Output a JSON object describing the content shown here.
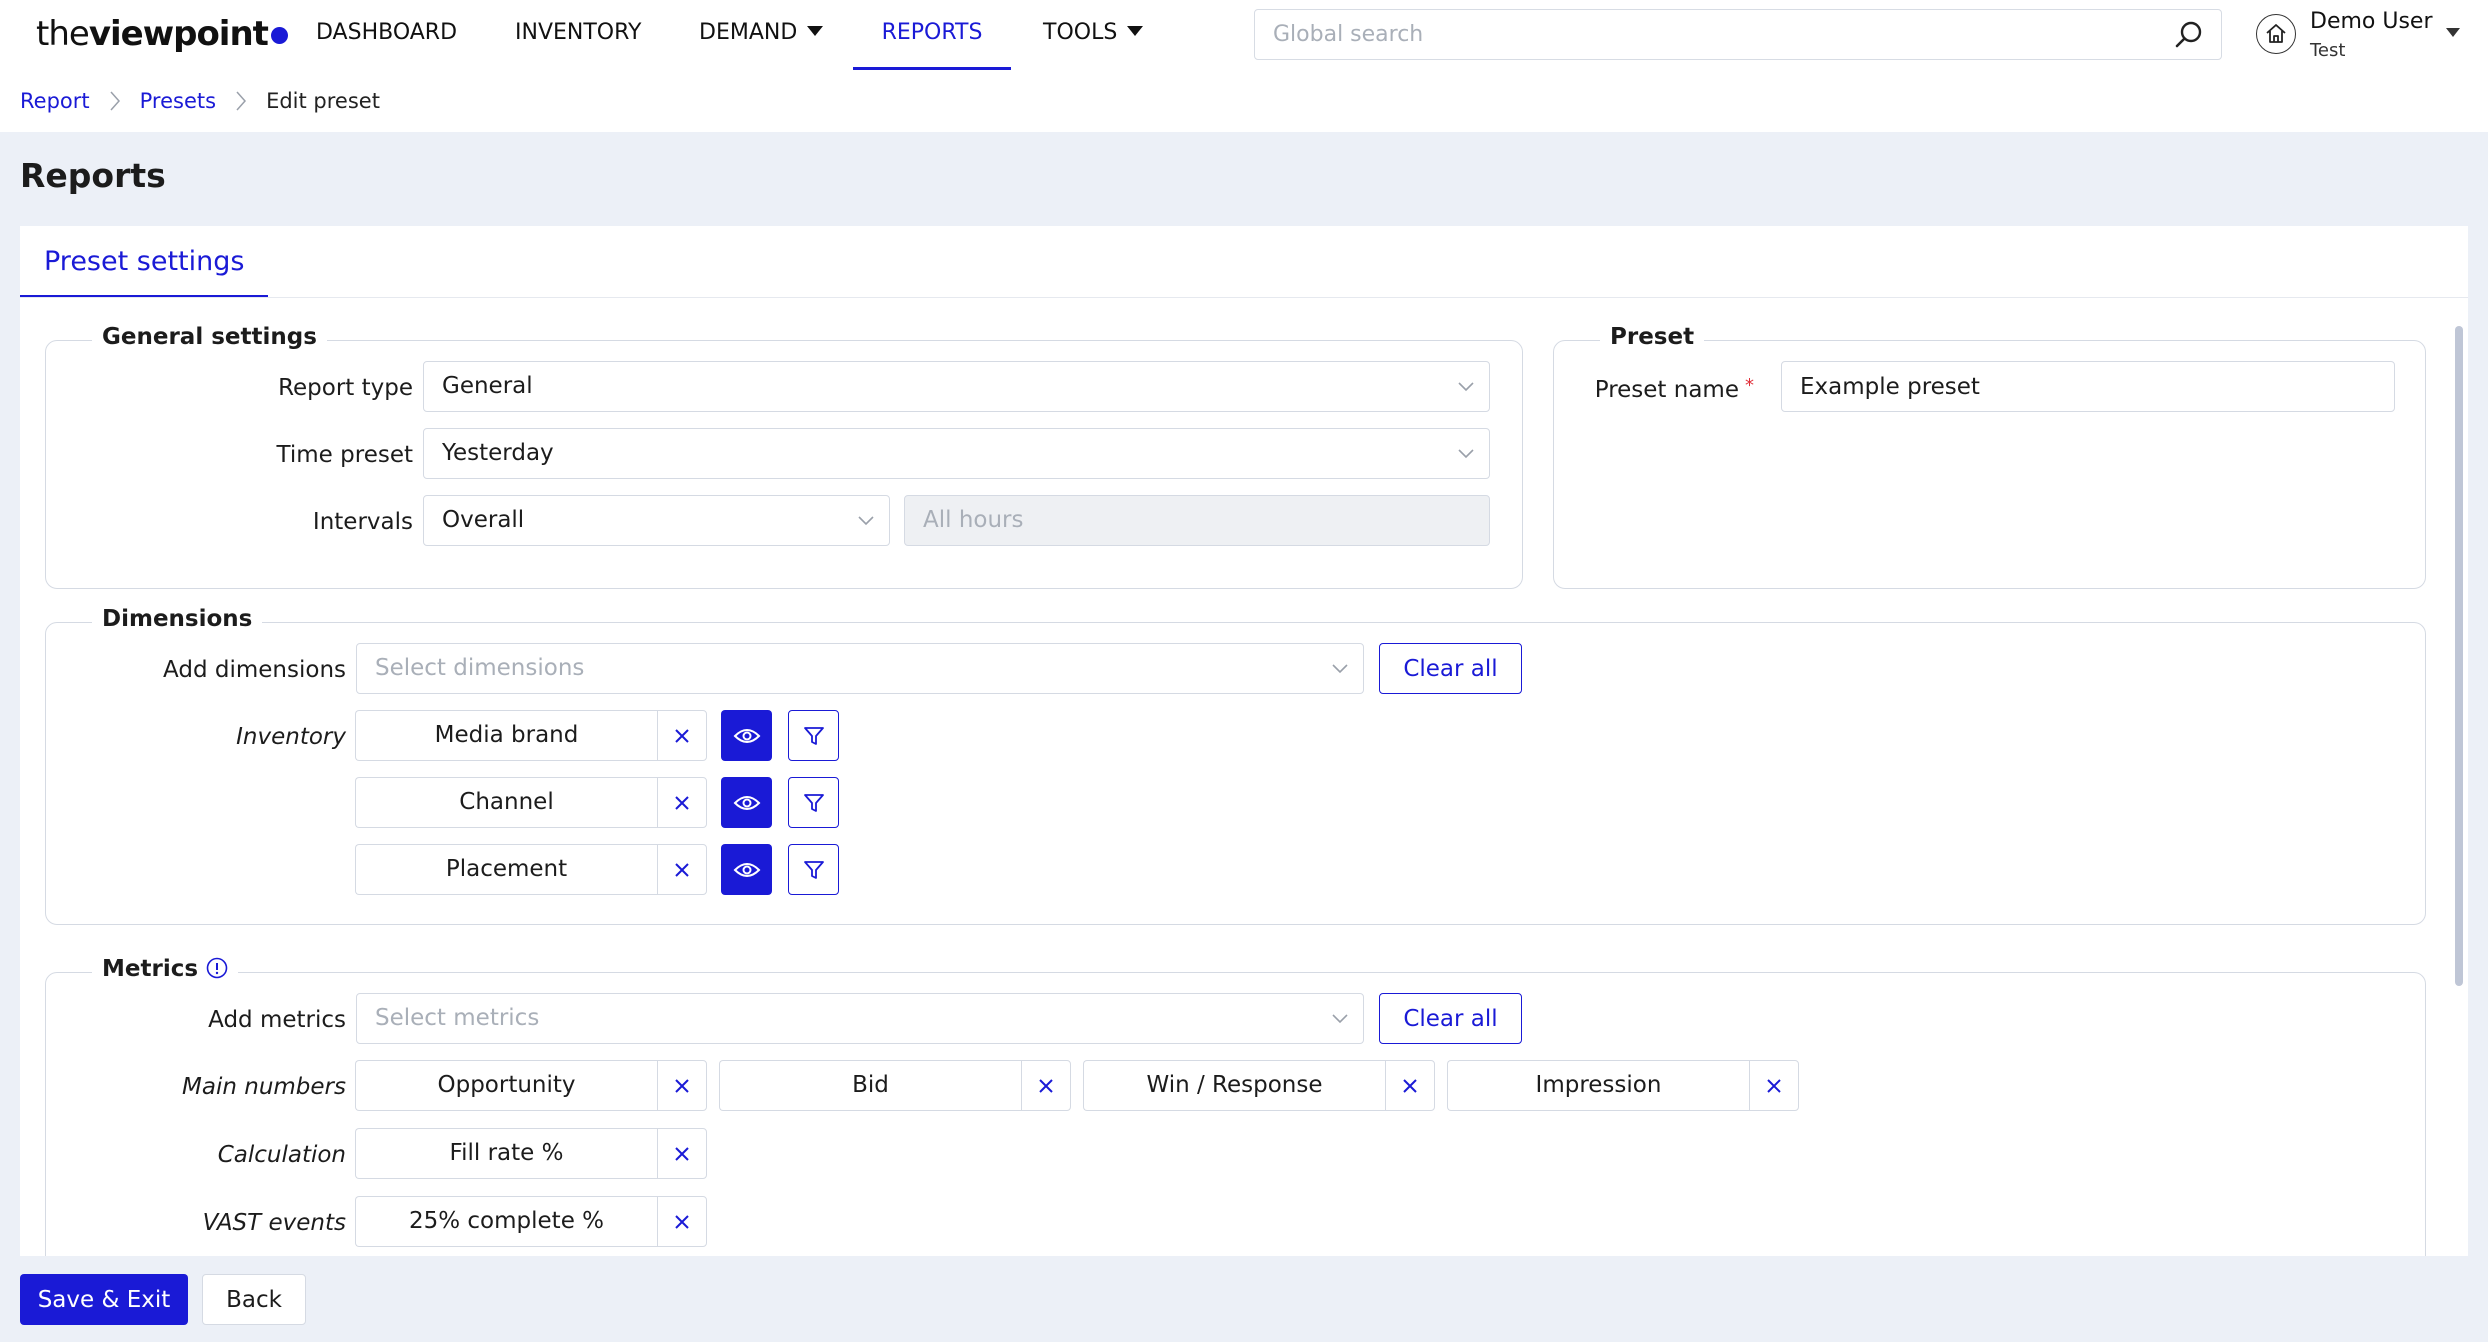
{
  "brand": {
    "logo_light": "the",
    "logo_bold": "viewpoint",
    "accent": "#1a1ad6"
  },
  "nav": {
    "items": [
      {
        "label": "DASHBOARD",
        "dropdown": false,
        "active": false
      },
      {
        "label": "INVENTORY",
        "dropdown": false,
        "active": false
      },
      {
        "label": "DEMAND",
        "dropdown": true,
        "active": false
      },
      {
        "label": "REPORTS",
        "dropdown": false,
        "active": true
      },
      {
        "label": "TOOLS",
        "dropdown": true,
        "active": false
      }
    ],
    "search_placeholder": "Global search",
    "user": {
      "name": "Demo User",
      "sub": "Test"
    }
  },
  "breadcrumb": {
    "items": [
      "Report",
      "Presets"
    ],
    "current": "Edit preset"
  },
  "page_title": "Reports",
  "tab": "Preset settings",
  "general": {
    "title": "General settings",
    "report_type_label": "Report type",
    "report_type_value": "General",
    "time_preset_label": "Time preset",
    "time_preset_value": "Yesterday",
    "intervals_label": "Intervals",
    "intervals_value": "Overall",
    "hours_value": "All hours"
  },
  "preset": {
    "title": "Preset",
    "name_label": "Preset name",
    "name_value": "Example preset"
  },
  "dimensions": {
    "title": "Dimensions",
    "add_label": "Add dimensions",
    "add_placeholder": "Select dimensions",
    "clear_label": "Clear all",
    "group_label": "Inventory",
    "chips": [
      "Media brand",
      "Channel",
      "Placement"
    ]
  },
  "metrics": {
    "title": "Metrics",
    "add_label": "Add metrics",
    "add_placeholder": "Select metrics",
    "clear_label": "Clear all",
    "groups": [
      {
        "label": "Main numbers",
        "chips": [
          "Opportunity",
          "Bid",
          "Win / Response",
          "Impression"
        ]
      },
      {
        "label": "Calculation",
        "chips": [
          "Fill rate %"
        ]
      },
      {
        "label": "VAST events",
        "chips": [
          "25% complete %"
        ]
      }
    ]
  },
  "footer": {
    "save_label": "Save & Exit",
    "back_label": "Back"
  }
}
